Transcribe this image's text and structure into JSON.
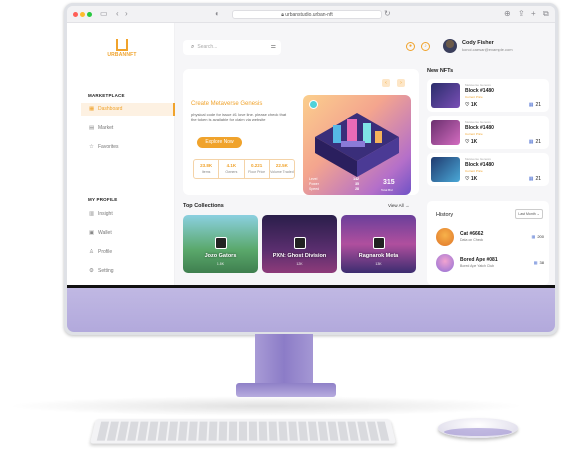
{
  "browser": {
    "url": "urbanstudio.urban-nft",
    "colors": {
      "close": "#ff5f57",
      "minimize": "#febc2e",
      "maximize": "#28c840"
    }
  },
  "brand": {
    "name": "URBANNFT",
    "accent": "#f0a32c"
  },
  "sidebar": {
    "marketplace_label": "MARKETPLACE",
    "marketplace_items": [
      {
        "label": "Dashboard",
        "icon": "grid-icon"
      },
      {
        "label": "Market",
        "icon": "market-icon"
      },
      {
        "label": "Favorites",
        "icon": "star-icon"
      }
    ],
    "profile_label": "MY PROFILE",
    "profile_items": [
      {
        "label": "Insight",
        "icon": "chart-icon"
      },
      {
        "label": "Wallet",
        "icon": "wallet-icon"
      },
      {
        "label": "Profile",
        "icon": "user-icon"
      },
      {
        "label": "Setting",
        "icon": "gear-icon"
      }
    ]
  },
  "header": {
    "search_placeholder": "Search...",
    "user_name": "Cody Fisher",
    "user_email": "konoi.caesar@example.com"
  },
  "hero": {
    "title": "Create Metaverse Genesis",
    "description": "physical code for issue #1 love line. please check that the token is available for claim via website",
    "button_label": "Explore Now",
    "stats": [
      {
        "value": "23.8K",
        "label": "Items"
      },
      {
        "value": "4.1K",
        "label": "Owners"
      },
      {
        "value": "0.221",
        "label": "Floor Price"
      },
      {
        "value": "22.5K",
        "label": "Volume Traded"
      }
    ],
    "art_stats": [
      {
        "label": "Level",
        "value": "142"
      },
      {
        "label": "Power",
        "value": "35"
      },
      {
        "label": "Speed",
        "value": "28"
      }
    ],
    "art_number": "315",
    "art_number_sub": "Total Bid"
  },
  "collections": {
    "title": "Top Collections",
    "view_all": "View All",
    "items": [
      {
        "name": "Jozo Gators",
        "sub": "1.8K"
      },
      {
        "name": "PXN: Ghost Division",
        "sub": "12K"
      },
      {
        "name": "Ragnarok Meta",
        "sub": "13K"
      }
    ]
  },
  "new_nfts": {
    "title": "New NFTs",
    "items": [
      {
        "tag": "Metaverse Genesis",
        "name": "Block #1480",
        "price": "Current Price",
        "likes": "1K",
        "count": "21"
      },
      {
        "tag": "Metaverse Genesis",
        "name": "Block #1480",
        "price": "Current Price",
        "likes": "1K",
        "count": "21"
      },
      {
        "tag": "Metaverse Genesis",
        "name": "Block #1480",
        "price": "Current Price",
        "likes": "1K",
        "count": "21"
      }
    ]
  },
  "history": {
    "title": "History",
    "filter": "Last Month",
    "items": [
      {
        "name": "Cat #6662",
        "sub": "Data on Check",
        "value": "200"
      },
      {
        "name": "Bored Ape #081",
        "sub": "Bored Ape Yatch Club",
        "value": "38"
      }
    ]
  }
}
